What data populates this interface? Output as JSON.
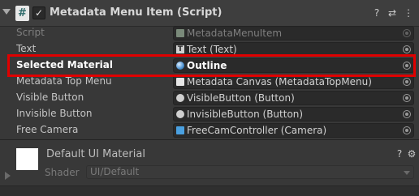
{
  "component": {
    "title": "Metadata Menu Item (Script)",
    "script_icon_glyph": "#",
    "enabled_glyph": "✓",
    "help_glyph": "?",
    "presets_glyph": "⇄",
    "menu_glyph": "⋮"
  },
  "fields": [
    {
      "label": "Script",
      "value": "MetadataMenuItem",
      "icon": "script-asset-icon",
      "disabled": true
    },
    {
      "label": "Text",
      "value": "Text (Text)",
      "icon": "text-component-icon",
      "disabled": false
    },
    {
      "label": "Selected Material",
      "value": "Outline",
      "icon": "material-icon",
      "disabled": false,
      "highlighted": true
    },
    {
      "label": "Metadata Top Menu",
      "value": "Metadata Canvas (MetadataTopMenu)",
      "icon": "script-component-icon",
      "disabled": false
    },
    {
      "label": "Visible Button",
      "value": "VisibleButton (Button)",
      "icon": "button-component-icon",
      "disabled": false
    },
    {
      "label": "Invisible Button",
      "value": "InvisibleButton (Button)",
      "icon": "button-component-icon",
      "disabled": false
    },
    {
      "label": "Free Camera",
      "value": "FreeCamController (Camera)",
      "icon": "camera-component-icon",
      "disabled": false
    }
  ],
  "material": {
    "title": "Default UI Material",
    "shader_label": "Shader",
    "shader_value": "UI/Default",
    "help_glyph": "?",
    "settings_glyph": "⚙"
  },
  "colors": {
    "highlight_border": "#e00000",
    "background": "#383838"
  }
}
